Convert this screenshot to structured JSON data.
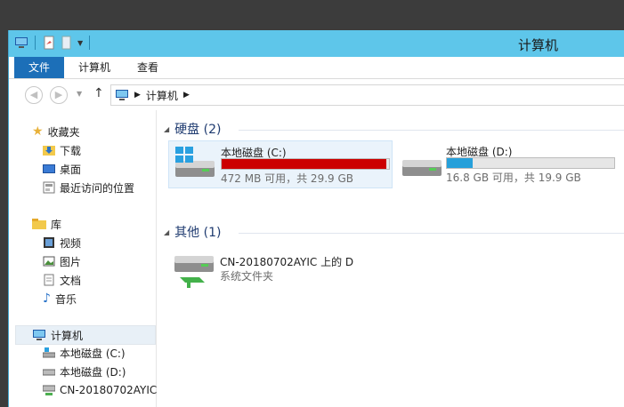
{
  "window": {
    "title": "计算机"
  },
  "ribbon": {
    "tabs": [
      {
        "label": "文件"
      },
      {
        "label": "计算机"
      },
      {
        "label": "查看"
      }
    ]
  },
  "address": {
    "path": "计算机"
  },
  "nav": {
    "favorites": {
      "label": "收藏夹",
      "items": [
        {
          "label": "下载"
        },
        {
          "label": "桌面"
        },
        {
          "label": "最近访问的位置"
        }
      ]
    },
    "libraries": {
      "label": "库",
      "items": [
        {
          "label": "视频"
        },
        {
          "label": "图片"
        },
        {
          "label": "文档"
        },
        {
          "label": "音乐"
        }
      ]
    },
    "computer": {
      "label": "计算机",
      "items": [
        {
          "label": "本地磁盘 (C:)"
        },
        {
          "label": "本地磁盘 (D:)"
        },
        {
          "label": "CN-20180702AYIC"
        }
      ]
    }
  },
  "content": {
    "hard_drives": {
      "header": "硬盘 (2)",
      "drives": [
        {
          "name": "本地磁盘 (C:)",
          "space": "472 MB 可用，共 29.9 GB",
          "used_fraction": 0.985,
          "bar_color": "#cc0000"
        },
        {
          "name": "本地磁盘 (D:)",
          "space": "16.8 GB 可用，共 19.9 GB",
          "used_fraction": 0.156,
          "bar_color": "#26a0da"
        }
      ]
    },
    "other": {
      "header": "其他 (1)",
      "items": [
        {
          "name": "CN-20180702AYIC 上的 D",
          "type": "系统文件夹"
        }
      ]
    }
  }
}
